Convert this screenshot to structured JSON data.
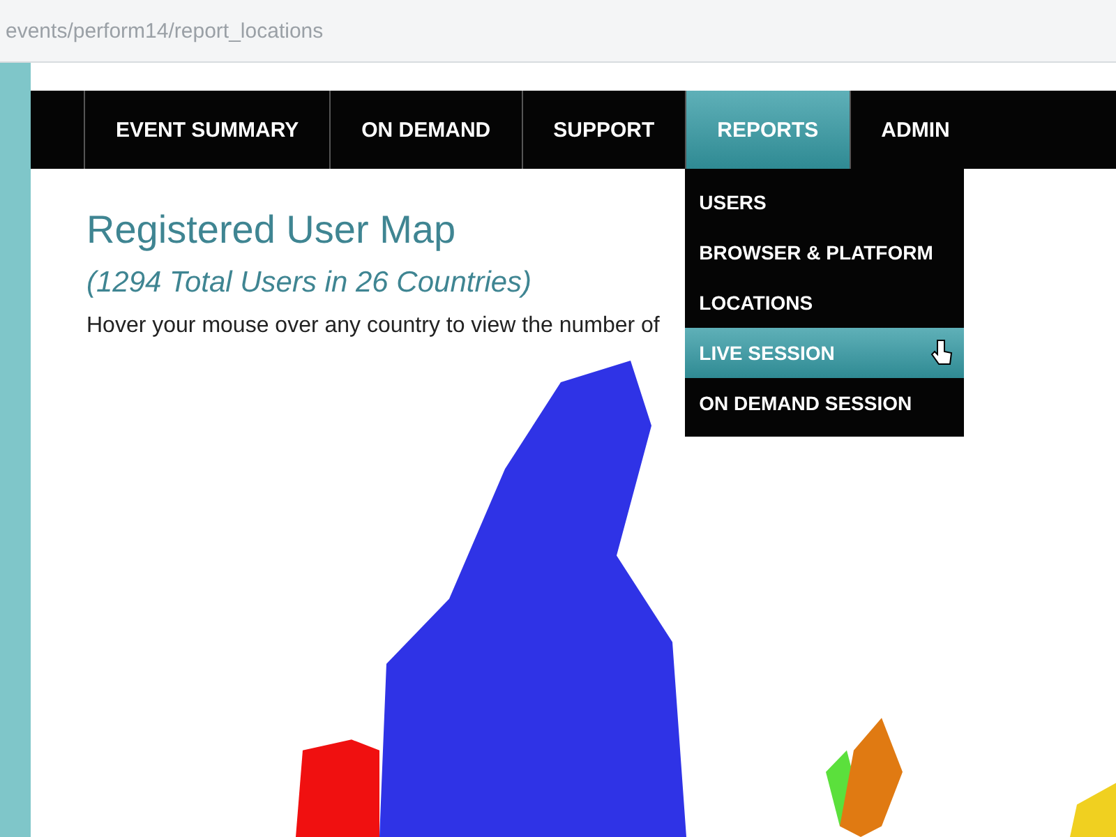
{
  "address_bar": {
    "url": "events/perform14/report_locations"
  },
  "nav": [
    {
      "label": "EVENT SUMMARY",
      "selected": false
    },
    {
      "label": "ON DEMAND",
      "selected": false
    },
    {
      "label": "SUPPORT",
      "selected": false
    },
    {
      "label": "REPORTS",
      "selected": true
    },
    {
      "label": "ADMIN",
      "selected": false
    }
  ],
  "dropdown": [
    {
      "label": "USERS",
      "selected": false
    },
    {
      "label": "BROWSER & PLATFORM",
      "selected": false
    },
    {
      "label": "LOCATIONS",
      "selected": false
    },
    {
      "label": "LIVE SESSION",
      "selected": true
    },
    {
      "label": "ON DEMAND SESSION",
      "selected": false
    }
  ],
  "heading": "Registered User Map",
  "subheading": "(1294 Total Users in 26 Countries)",
  "hint": "Hover your mouse over any country to view the number of"
}
